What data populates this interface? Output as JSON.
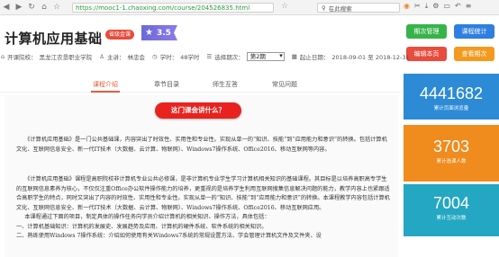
{
  "browser": {
    "url": "https://mooc1-1.chaoxing.com/course/204526835.html",
    "search_placeholder": "在此搜索",
    "icons": [
      "back-icon",
      "forward-icon",
      "reload-icon",
      "home-icon",
      "star-icon"
    ]
  },
  "header": {
    "title": "计算机应用基础",
    "badge": "省级金课",
    "score": "3.5",
    "buttons": {
      "period_manage": "期次管理",
      "course_stats": "课程统计",
      "edit_page": "编辑本页",
      "view_period": "查看期次"
    },
    "meta": {
      "school_label": "开课院校：",
      "school": "黑龙江农垦职业学院",
      "host_label": "主讲：",
      "host": "林忠会",
      "hours_label": "学时：",
      "hours": "48学时",
      "period_label": "选择期次：",
      "period": "第2期",
      "dates_label": "起止日期：",
      "dates": "2018-09-01 至 2018-12-31"
    }
  },
  "tabs": [
    {
      "label": "课程介绍",
      "active": true
    },
    {
      "label": "章节目录",
      "active": false
    },
    {
      "label": "师生互答",
      "active": false
    },
    {
      "label": "常见问题",
      "active": false
    }
  ],
  "content": {
    "pill": "这门课会讲什么？",
    "para1": "《计算机应用基础》是一门公共基础课，内容突出了时效性、实用性和专业性。实现从单一的“知识、技能”到“应用能力和意识”的转换。包括计算机文化、互联网信息安全、新一代IT技术（大数据、云计算、物联网）、Windows7操作系统、Office2016、移动互联网等内容。",
    "para2": "《计算机应用基础》课程是高职院校非计算机专业公共必修课，是非计算机专业学生学习计算机相关知识的基础课程。其目标是以培养高职高专学生的互联网信息素养为核心，不仅仅注重Office办公软件操作能力的培养，更重视的是培养学生利用互联网搜集信息解决问题的能力，教学内容上也紧跟适合高职学生的特点，同时又突出了内容的时效性、实用性和专业性。实现从单一的“知识、技能”到“应用能力和意识”的转换。本课程教学内容包括计算机文化、互联网信息安全、新一代IT技术（大数据、云计算、物联网）、Windows7操作系统、Office2016、移动互联网应用。",
    "line3": "本课程通过下面的项目，制定具体的操作任务向学员介绍计算机的相关知识、操作方法，具体包括：",
    "line4": "一、计算机基础知识：计算机的发展史、发展趋势及应用、计算机的硬件系统、软件系统的相关知识。",
    "line5": "二、熟练使用Windows 7操作系统：介绍如何使用有关Windows7系统的常规设置方法、学会管理计算机文件及文件夹、设"
  },
  "stats": [
    {
      "value": "4441682",
      "label": "累计页面浏览量",
      "color": "#2d8bd6"
    },
    {
      "value": "3703",
      "label": "累计选课人数",
      "color": "#f08b1d"
    },
    {
      "value": "7004",
      "label": "累计互动次数",
      "color": "#24a7c2"
    }
  ],
  "colors": {
    "accent": "#e05d3a",
    "pill_red": "#e8231f",
    "btn_green": "#36b44a",
    "btn_blue": "#2f7ee0",
    "btn_red": "#e94b3c",
    "btn_orange": "#f39a1e"
  }
}
